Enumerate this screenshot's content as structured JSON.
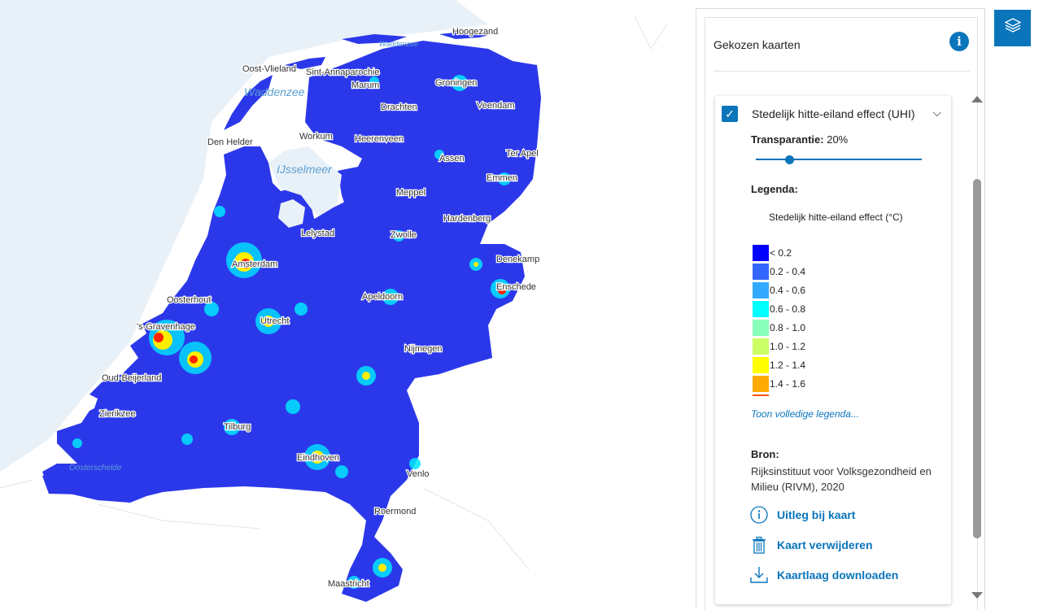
{
  "panel": {
    "title": "Gekozen kaarten",
    "layer": {
      "title": "Stedelijk hitte-eiland effect (UHI)",
      "transparency_label": "Transparantie:",
      "transparency_value": "20%",
      "transparency_percent": 20,
      "legend_heading": "Legenda:",
      "legend_title": "Stedelijk hitte-eiland effect (°C)",
      "legend_items": [
        {
          "label": "< 0.2",
          "color": "#0000ff"
        },
        {
          "label": "0.2 - 0.4",
          "color": "#3366ff"
        },
        {
          "label": "0.4 - 0.6",
          "color": "#33aaff"
        },
        {
          "label": "0.6 - 0.8",
          "color": "#00ffff"
        },
        {
          "label": "0.8 - 1.0",
          "color": "#88ffbb"
        },
        {
          "label": "1.0 - 1.2",
          "color": "#ccff66"
        },
        {
          "label": "1.2 - 1.4",
          "color": "#ffff00"
        },
        {
          "label": "1.4 - 1.6",
          "color": "#ffaa00"
        },
        {
          "label": "",
          "color": "#ff5500"
        }
      ],
      "full_legend_link": "Toon volledige legenda...",
      "source_heading": "Bron:",
      "source_text": "Rijksinstituut voor Volksgezondheid en Milieu (RIVM), 2020",
      "actions": {
        "explain": "Uitleg bij kaart",
        "remove": "Kaart verwijderen",
        "download": "Kaartlaag downloaden"
      }
    }
  },
  "map": {
    "water_labels": [
      "Waddenzee",
      "IJsselmeer",
      "Waddenzee",
      "Oosterschelde"
    ],
    "place_labels": [
      "Oost-Vlieland",
      "Sint-Annaparochie",
      "Den Helder",
      "Workum",
      "Heerenveen",
      "Drachten",
      "Groningen",
      "Veendam",
      "Ter Apel",
      "Emmen",
      "Assen",
      "Meppel",
      "Hardenberg",
      "Lelystad",
      "Amsterdam",
      "Zwolle",
      "Apeldoorn",
      "Enschede",
      "Denekamp",
      "'s-Gravenhage",
      "Utrecht",
      "Oud-Beijerland",
      "Nijmegen",
      "Zierikzee",
      "Eindhoven",
      "Tilburg",
      "Venlo",
      "Roermond",
      "Maastricht",
      "Hoogezand",
      "Oosterhout",
      "Marum"
    ],
    "colors": {
      "land": "#2b38ea",
      "sea": "#e6f0f7",
      "hot": "#ff2200"
    }
  }
}
